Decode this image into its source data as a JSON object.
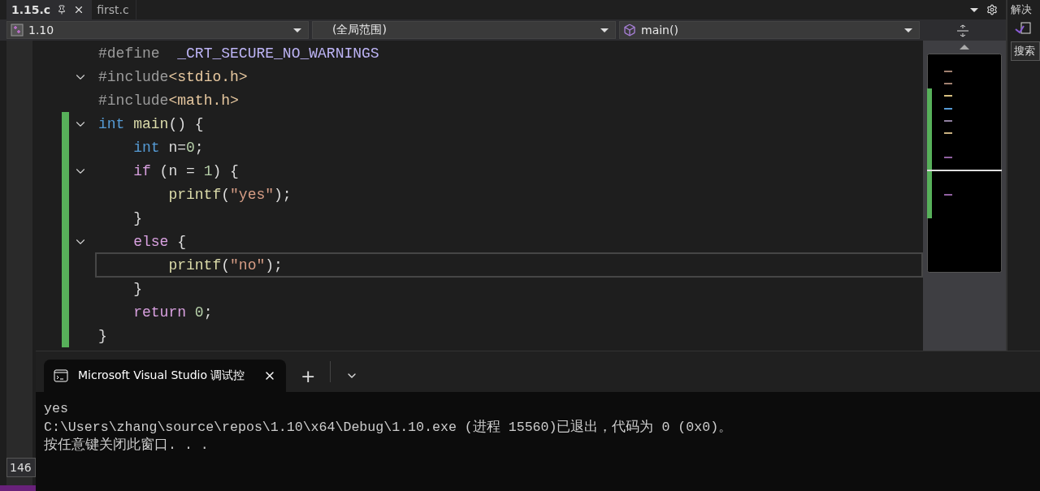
{
  "doc_tabs": [
    {
      "label": "1.15.c",
      "selected": true
    },
    {
      "label": "first.c",
      "selected": false
    }
  ],
  "nav_bar": {
    "project": "1.10",
    "scope": "(全局范围)",
    "member": "main()"
  },
  "code_lines": [
    {
      "fold_marker": false,
      "changed": false,
      "current": false,
      "tokens": [
        {
          "text": "#define",
          "kind": "directive"
        },
        {
          "text": "  _CRT_SECURE_NO_WARNINGS",
          "kind": "macro"
        }
      ]
    },
    {
      "fold_marker": true,
      "changed": false,
      "current": false,
      "tokens": [
        {
          "text": "#include",
          "kind": "directive"
        },
        {
          "text": "<stdio.h>",
          "kind": "header"
        }
      ]
    },
    {
      "fold_marker": false,
      "changed": false,
      "current": false,
      "tokens": [
        {
          "text": "#include",
          "kind": "directive"
        },
        {
          "text": "<math.h>",
          "kind": "header"
        }
      ]
    },
    {
      "fold_marker": true,
      "changed": true,
      "current": false,
      "tokens": [
        {
          "text": "int",
          "kind": "type"
        },
        {
          "text": " main",
          "kind": "func"
        },
        {
          "text": "() {",
          "kind": "plain"
        }
      ]
    },
    {
      "fold_marker": false,
      "changed": true,
      "current": false,
      "tokens": [
        {
          "text": "    int",
          "kind": "type"
        },
        {
          "text": " n=",
          "kind": "plain"
        },
        {
          "text": "0",
          "kind": "number"
        },
        {
          "text": ";",
          "kind": "plain"
        }
      ]
    },
    {
      "fold_marker": true,
      "changed": true,
      "current": false,
      "tokens": [
        {
          "text": "    if",
          "kind": "control"
        },
        {
          "text": " (n = ",
          "kind": "plain"
        },
        {
          "text": "1",
          "kind": "number"
        },
        {
          "text": ") {",
          "kind": "plain"
        }
      ]
    },
    {
      "fold_marker": false,
      "changed": true,
      "current": false,
      "tokens": [
        {
          "text": "        printf",
          "kind": "func"
        },
        {
          "text": "(",
          "kind": "plain"
        },
        {
          "text": "\"yes\"",
          "kind": "string"
        },
        {
          "text": ");",
          "kind": "plain"
        }
      ]
    },
    {
      "fold_marker": false,
      "changed": true,
      "current": false,
      "tokens": [
        {
          "text": "    }",
          "kind": "plain"
        }
      ]
    },
    {
      "fold_marker": true,
      "changed": true,
      "current": false,
      "tokens": [
        {
          "text": "    else",
          "kind": "control"
        },
        {
          "text": " {",
          "kind": "plain"
        }
      ]
    },
    {
      "fold_marker": false,
      "changed": true,
      "current": true,
      "tokens": [
        {
          "text": "        printf",
          "kind": "func"
        },
        {
          "text": "(",
          "kind": "plain"
        },
        {
          "text": "\"no\"",
          "kind": "string"
        },
        {
          "text": ");",
          "kind": "plain"
        }
      ]
    },
    {
      "fold_marker": false,
      "changed": true,
      "current": false,
      "tokens": [
        {
          "text": "    }",
          "kind": "plain"
        }
      ]
    },
    {
      "fold_marker": false,
      "changed": true,
      "current": false,
      "tokens": [
        {
          "text": "    return",
          "kind": "control"
        },
        {
          "text": " 0",
          "kind": "number"
        },
        {
          "text": ";",
          "kind": "plain"
        }
      ]
    },
    {
      "fold_marker": false,
      "changed": true,
      "current": false,
      "tokens": [
        {
          "text": "}",
          "kind": "plain"
        }
      ]
    }
  ],
  "zoom_level": "146",
  "side_panel": {
    "title": "解决",
    "search": "搜索"
  },
  "console": {
    "tab_title": "Microsoft Visual Studio 调试控",
    "add": "+",
    "output": [
      "yes",
      "C:\\Users\\zhang\\source\\repos\\1.10\\x64\\Debug\\1.10.exe (进程 15560)已退出，代码为 0 (0x0)。",
      "按任意键关闭此窗口. . ."
    ]
  }
}
